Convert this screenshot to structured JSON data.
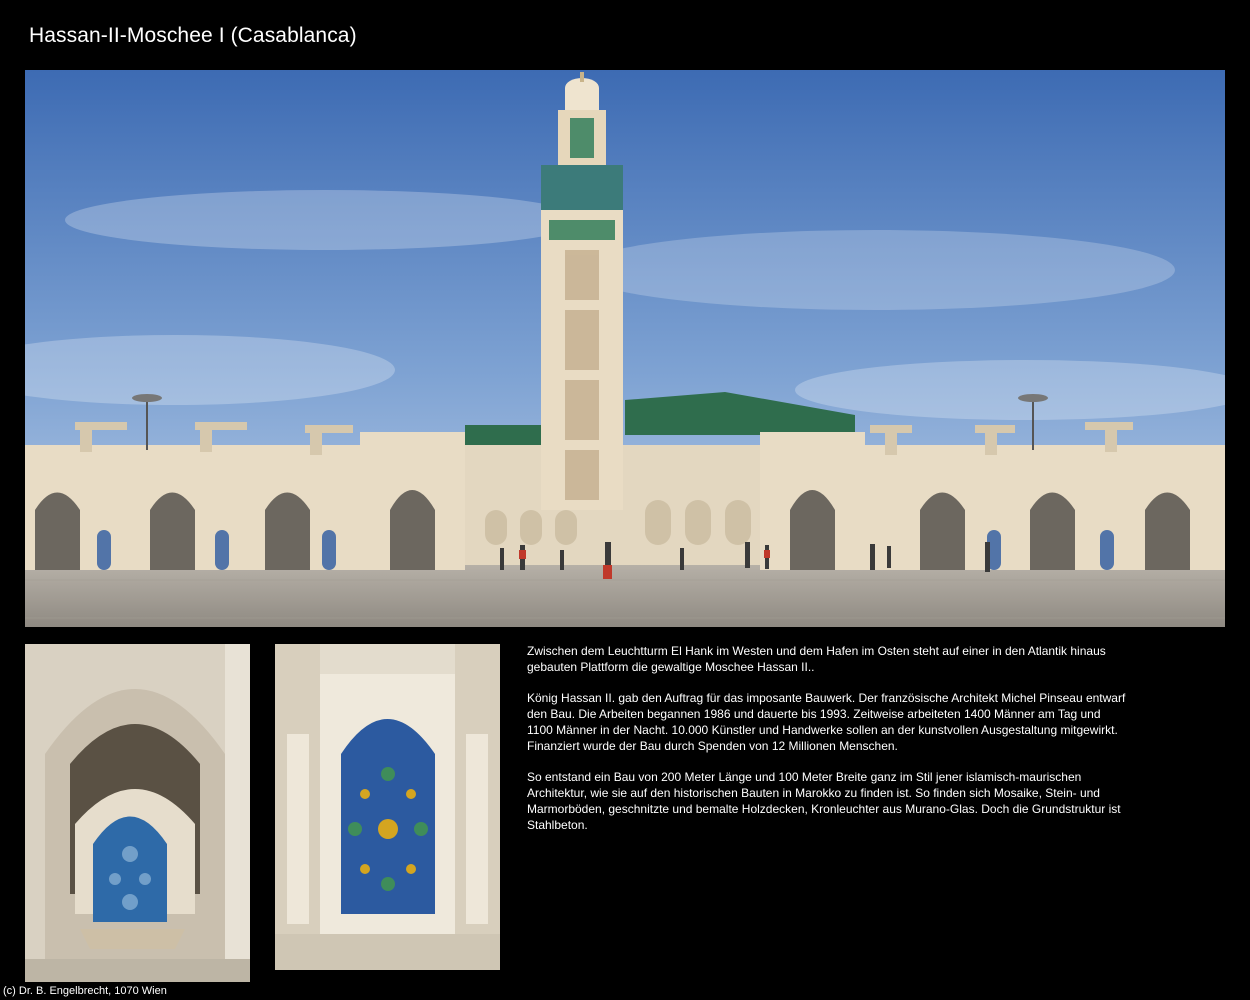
{
  "page": {
    "title": "Hassan-II-Moschee I (Casablanca)",
    "copyright": "(c) Dr. B. Engelbrecht, 1070 Wien"
  },
  "photos": {
    "main": {
      "subject": "mosque-minaret-courtyard"
    },
    "fountain": {
      "subject": "ablution-fountain-mosaic"
    },
    "tiles": {
      "subject": "zellige-tile-panel"
    }
  },
  "description": {
    "paragraphs": [
      "Zwischen dem Leuchtturm El Hank im Westen und dem Hafen im Osten steht auf einer in den Atlantik hinaus gebauten Plattform die gewaltige Moschee Hassan II..",
      "König Hassan II. gab den Auftrag für das imposante Bauwerk. Der französische Architekt Michel Pinseau entwarf den Bau. Die Arbeiten begannen 1986 und dauerte bis 1993. Zeitweise arbeiteten 1400 Männer am Tag und 1100 Männer in der Nacht. 10.000 Künstler und Handwerke sollen an der kunstvollen Ausgestaltung mitgewirkt. Finanziert wurde der Bau durch Spenden von 12 Millionen Menschen.",
      "So entstand ein Bau von 200 Meter Länge und 100 Meter Breite ganz im Stil jener islamisch-maurischen Architektur, wie sie auf den historischen Bauten in Marokko zu finden ist. So finden sich Mosaike, Stein- und Marmorböden, geschnitzte und bemalte Holzdecken, Kronleuchter aus Murano-Glas. Doch die Grundstruktur ist Stahlbeton."
    ]
  },
  "colors": {
    "background": "#000000",
    "sky_top": "#3d6bb3",
    "sky_bottom": "#b9cde6",
    "stone": "#e6dac4",
    "roof_green": "#2f6d4d",
    "tile_blue": "#2c5aa0"
  }
}
